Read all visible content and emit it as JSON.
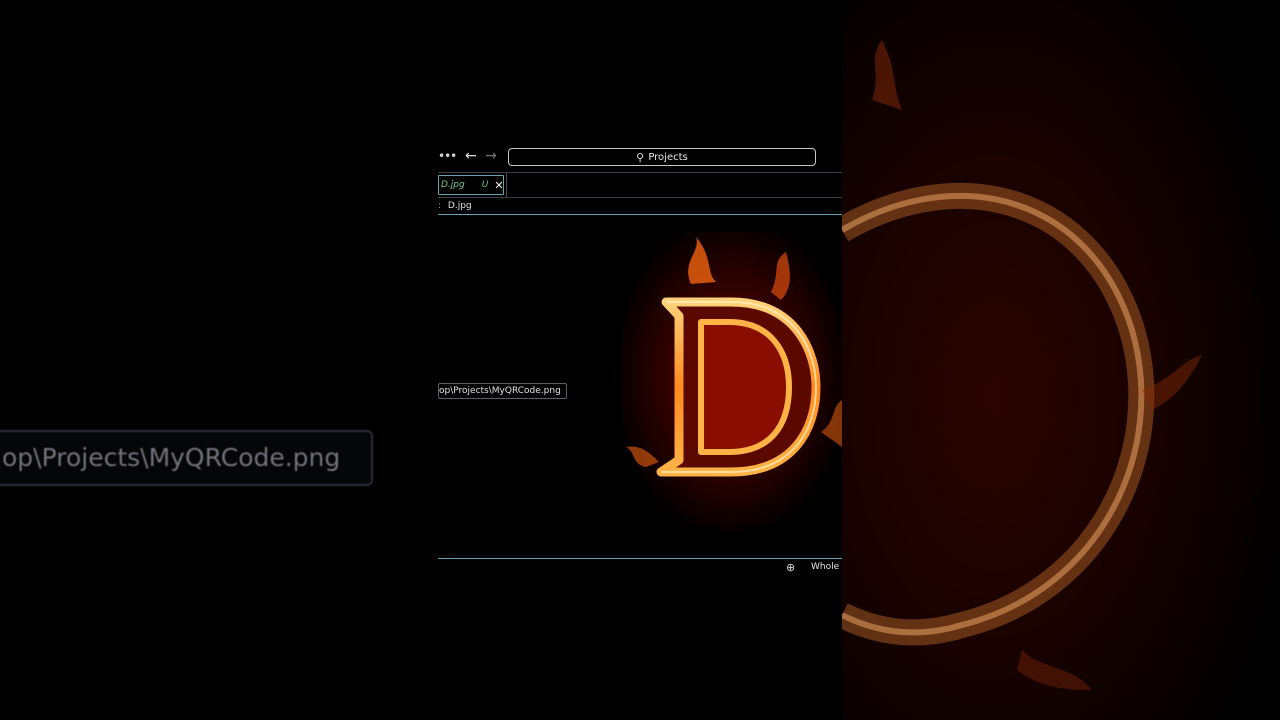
{
  "backdrop": {
    "blurred_path": "op\\Projects\\MyQRCode.png"
  },
  "titlebar": {
    "more_icon": "ellipsis-icon",
    "back_icon": "arrow-left-icon",
    "forward_icon": "arrow-right-icon",
    "search_label": "Projects"
  },
  "tabs": [
    {
      "name": "D.jpg",
      "status": "U",
      "close": "✕"
    }
  ],
  "breadcrumb": {
    "separator": ":",
    "file": "D.jpg"
  },
  "editor": {
    "path_tooltip": "op\\Projects\\MyQRCode.png"
  },
  "statusbar": {
    "zoom_label": "Whole I"
  },
  "colors": {
    "accent_border": "#6aa3b3",
    "untracked": "#73c991",
    "fire_orange": "#ff7a1a",
    "fire_red": "#b31200"
  }
}
